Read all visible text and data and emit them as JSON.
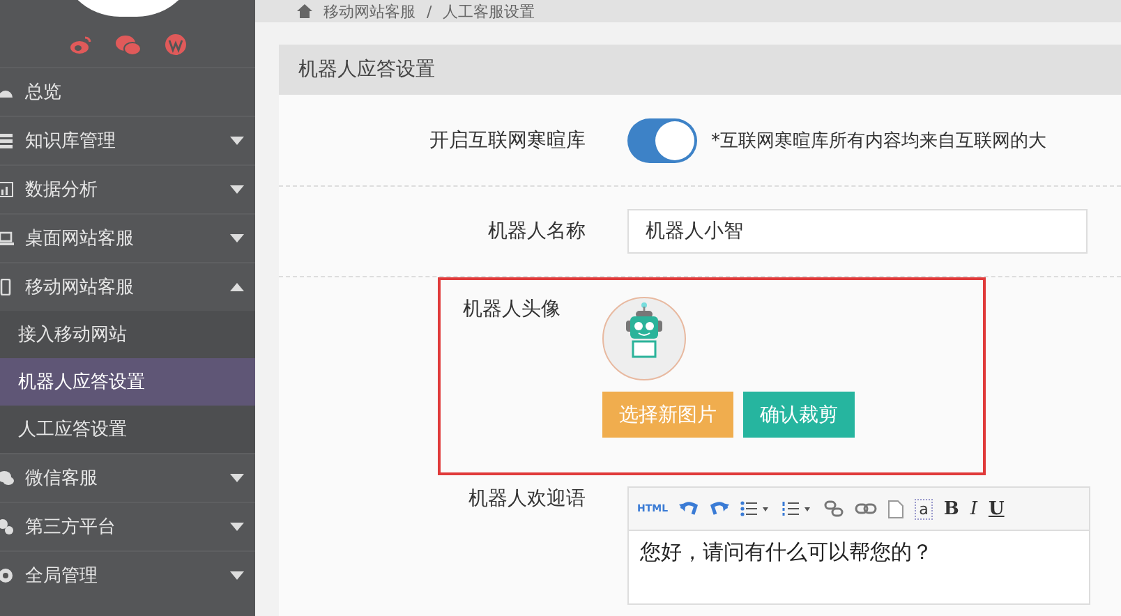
{
  "breadcrumb": {
    "items": [
      "移动网站客服",
      "人工客服设置"
    ],
    "separator": "/"
  },
  "sidebar": {
    "items": [
      {
        "label": "总览"
      },
      {
        "label": "知识库管理",
        "expanded": false
      },
      {
        "label": "数据分析",
        "expanded": false
      },
      {
        "label": "桌面网站客服",
        "expanded": false
      },
      {
        "label": "移动网站客服",
        "expanded": true,
        "children": [
          {
            "label": "接入移动网站",
            "selected": false
          },
          {
            "label": "机器人应答设置",
            "selected": true
          },
          {
            "label": "人工应答设置",
            "selected": false
          }
        ]
      },
      {
        "label": "微信客服",
        "expanded": false
      },
      {
        "label": "第三方平台",
        "expanded": false
      },
      {
        "label": "全局管理",
        "expanded": false
      }
    ]
  },
  "panel": {
    "title": "机器人应答设置",
    "rows": [
      {
        "kind": "switch",
        "label": "开启互联网寒暄库",
        "on": true,
        "note": "*互联网寒暄库所有内容均来自互联网的大"
      },
      {
        "kind": "input",
        "label": "机器人名称",
        "value": "机器人小智"
      },
      {
        "kind": "avatar",
        "label": "机器人头像",
        "highlighted": true,
        "buttons": [
          {
            "label": "选择新图片",
            "kind": "warning"
          },
          {
            "label": "确认裁剪",
            "kind": "primary"
          }
        ]
      },
      {
        "kind": "editor",
        "label": "机器人欢迎语",
        "toolbar": [
          {
            "kind": "text",
            "label": "HTML"
          },
          {
            "kind": "undo"
          },
          {
            "kind": "redo"
          },
          {
            "kind": "bullets"
          },
          {
            "kind": "numbers"
          },
          {
            "kind": "unlink"
          },
          {
            "kind": "link"
          },
          {
            "kind": "page"
          },
          {
            "kind": "anchor",
            "label": "a"
          },
          {
            "kind": "bold",
            "label": "B"
          },
          {
            "kind": "italic",
            "label": "I"
          },
          {
            "kind": "underline",
            "label": "U"
          }
        ],
        "value": "您好，请问有什么可以帮您的？"
      }
    ]
  }
}
